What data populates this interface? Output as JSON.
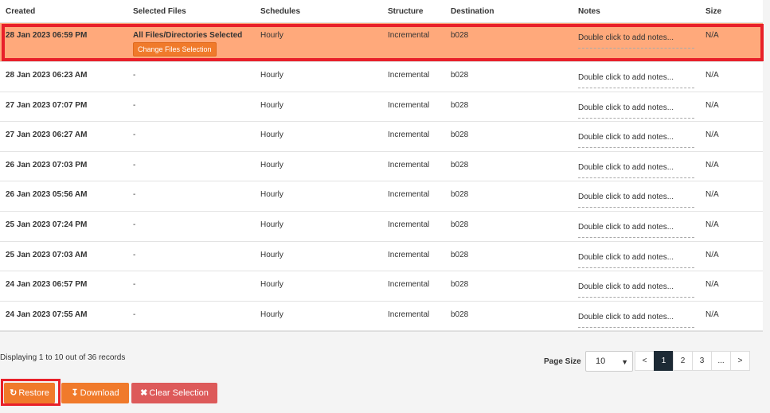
{
  "table": {
    "headers": [
      "Created",
      "Selected Files",
      "Schedules",
      "Structure",
      "Destination",
      "Notes",
      "Size"
    ],
    "rows": [
      {
        "created": "28 Jan 2023 06:59 PM",
        "files": "All Files/Directories Selected",
        "files_button": "Change Files Selection",
        "schedule": "Hourly",
        "structure": "Incremental",
        "destination": "b028",
        "notes": "Double click to add notes...",
        "size": "N/A"
      },
      {
        "created": "28 Jan 2023 06:23 AM",
        "files": "-",
        "schedule": "Hourly",
        "structure": "Incremental",
        "destination": "b028",
        "notes": "Double click to add notes...",
        "size": "N/A"
      },
      {
        "created": "27 Jan 2023 07:07 PM",
        "files": "-",
        "schedule": "Hourly",
        "structure": "Incremental",
        "destination": "b028",
        "notes": "Double click to add notes...",
        "size": "N/A"
      },
      {
        "created": "27 Jan 2023 06:27 AM",
        "files": "-",
        "schedule": "Hourly",
        "structure": "Incremental",
        "destination": "b028",
        "notes": "Double click to add notes...",
        "size": "N/A"
      },
      {
        "created": "26 Jan 2023 07:03 PM",
        "files": "-",
        "schedule": "Hourly",
        "structure": "Incremental",
        "destination": "b028",
        "notes": "Double click to add notes...",
        "size": "N/A"
      },
      {
        "created": "26 Jan 2023 05:56 AM",
        "files": "-",
        "schedule": "Hourly",
        "structure": "Incremental",
        "destination": "b028",
        "notes": "Double click to add notes...",
        "size": "N/A"
      },
      {
        "created": "25 Jan 2023 07:24 PM",
        "files": "-",
        "schedule": "Hourly",
        "structure": "Incremental",
        "destination": "b028",
        "notes": "Double click to add notes...",
        "size": "N/A"
      },
      {
        "created": "25 Jan 2023 07:03 AM",
        "files": "-",
        "schedule": "Hourly",
        "structure": "Incremental",
        "destination": "b028",
        "notes": "Double click to add notes...",
        "size": "N/A"
      },
      {
        "created": "24 Jan 2023 06:57 PM",
        "files": "-",
        "schedule": "Hourly",
        "structure": "Incremental",
        "destination": "b028",
        "notes": "Double click to add notes...",
        "size": "N/A"
      },
      {
        "created": "24 Jan 2023 07:55 AM",
        "files": "-",
        "schedule": "Hourly",
        "structure": "Incremental",
        "destination": "b028",
        "notes": "Double click to add notes...",
        "size": "N/A"
      }
    ]
  },
  "footer": {
    "records_text": "Displaying 1 to 10 out of 36 records",
    "page_size_label": "Page Size",
    "page_size_value": "10",
    "pager": [
      "<",
      "1",
      "2",
      "3",
      "...",
      ">"
    ],
    "active_page": "1"
  },
  "actions": {
    "restore": "Restore",
    "download": "Download",
    "clear": "Clear Selection"
  },
  "colors": {
    "selected_row": "#ffa97b",
    "accent": "#f07a2b",
    "danger": "#dd5a5a",
    "highlight_outline": "#e8202a"
  },
  "icons": {
    "restore": "refresh-icon",
    "download": "download-icon",
    "clear": "times-icon"
  }
}
